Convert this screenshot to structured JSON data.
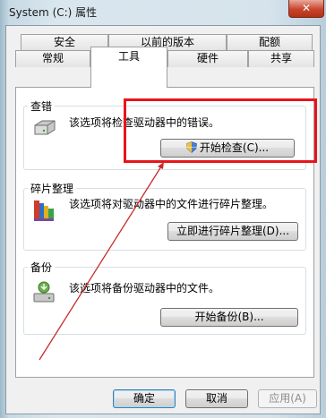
{
  "window": {
    "title": "System (C:) 属性",
    "close_symbol": "✕"
  },
  "tabs_row1": [
    {
      "label": "安全"
    },
    {
      "label": "以前的版本"
    },
    {
      "label": "配额"
    }
  ],
  "tabs_row2": [
    {
      "label": "常规"
    },
    {
      "label": "工具",
      "active": true
    },
    {
      "label": "硬件"
    },
    {
      "label": "共享"
    }
  ],
  "groups": {
    "check": {
      "title": "查错",
      "desc": "该选项将检查驱动器中的错误。",
      "button": "开始检查(C)...",
      "icon": "drive-check-icon"
    },
    "defrag": {
      "title": "碎片整理",
      "desc": "该选项将对驱动器中的文件进行碎片整理。",
      "button": "立即进行碎片整理(D)...",
      "icon": "defrag-icon"
    },
    "backup": {
      "title": "备份",
      "desc": "该选项将备份驱动器中的文件。",
      "button": "开始备份(B)...",
      "icon": "backup-icon"
    }
  },
  "footer": {
    "ok": "确定",
    "cancel": "取消",
    "apply": "应用(A)"
  },
  "colors": {
    "annotation": "#e8141b",
    "accent": "#3c7fb1"
  }
}
